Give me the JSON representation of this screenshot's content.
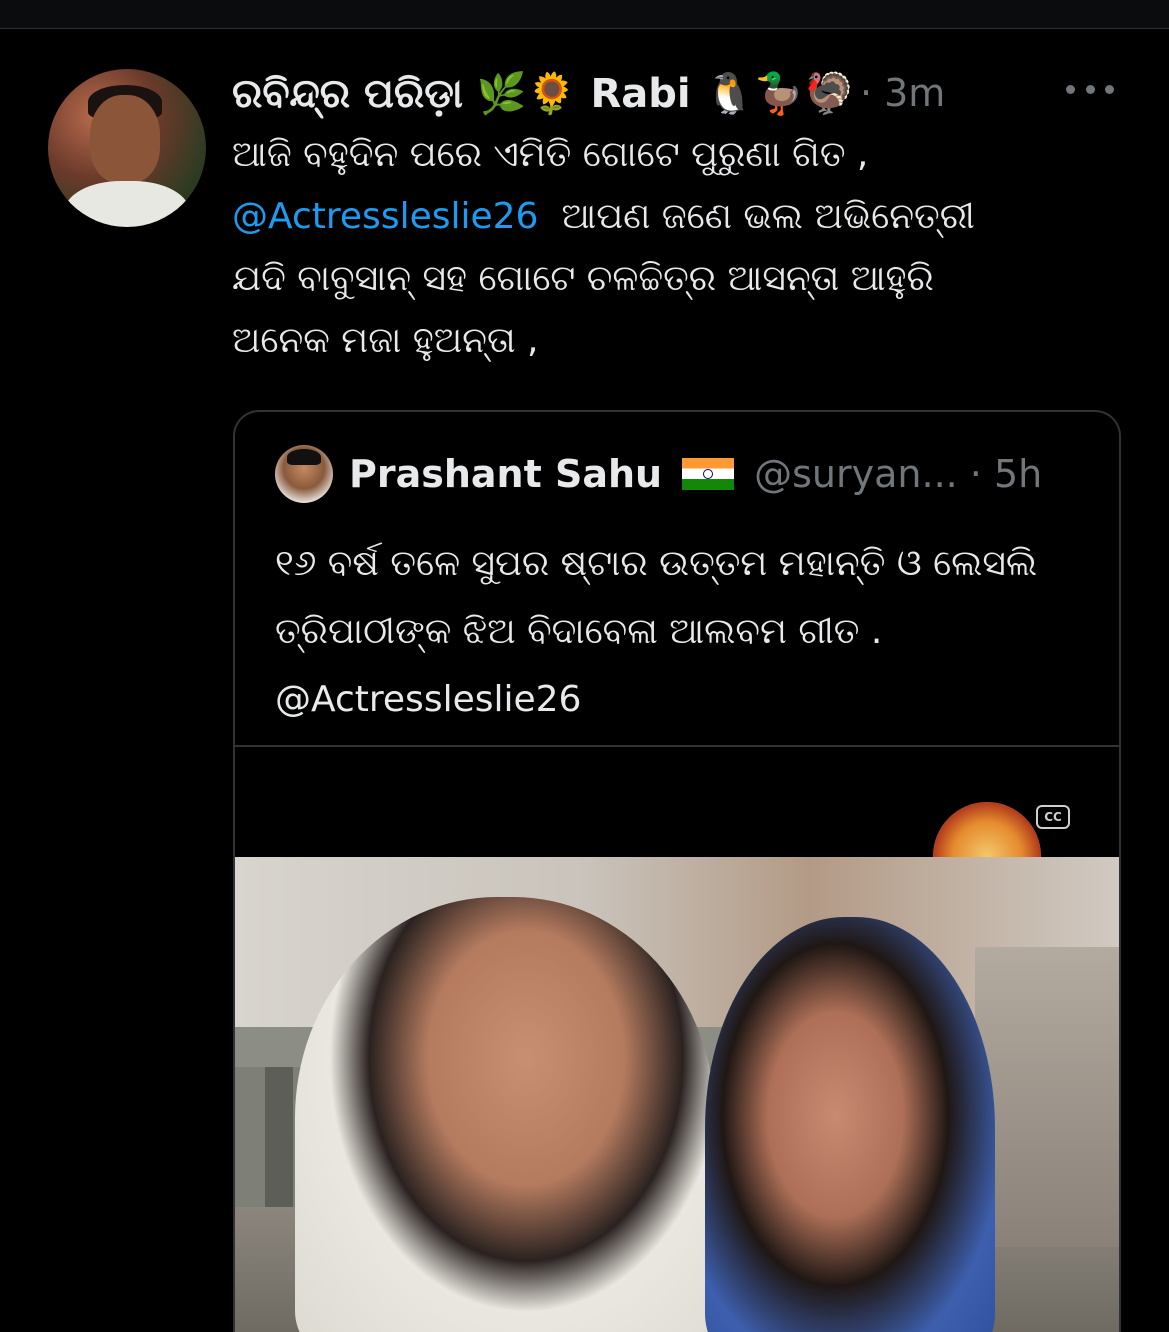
{
  "tweet": {
    "author": {
      "display_name": "ରବିନ୍ଦ୍ର ପରିଡ଼ା 🌿🌻 Rabi 🐧🦆🦃",
      "timestamp": "· 3m"
    },
    "text_lines": [
      "ଆଜି ବହୁଦିନ ପରେ ଏମିତି ଗୋଟେ ପୁରୁଣା ଗିତ ,",
      "ଆପଣ ଜଣେ ଭଲ ଅଭିନେତ୍ରୀ",
      "ଯଦି ବାବୁସାନ୍ ସହ ଗୋଟେ ଚଳଚ୍ଚିତ୍ର ଆସନ୍ତା ଆହୁରି",
      "ଅନେକ ମଜା ହୁଅନ୍ତା  ,"
    ],
    "mention": "@Actressleslie26",
    "more_icon": "more-horizontal-icon"
  },
  "quote": {
    "display_name": "Prashant Sahu",
    "flag_icon": "india-flag-icon",
    "handle_time": "@suryan... · 5h",
    "text_lines": [
      "୧୬ ବର୍ଷ ତଳେ ସୁପର ଷ୍ଟାର ଉତ୍ତମ ମହାନ୍ତି ଓ ଲେସଲି",
      "ତ୍ରିପାଠୀଙ୍କ ଝିଅ ବିଦାବେଳା ଆଲବମ ଗୀତ .",
      "@Actressleslie26"
    ],
    "media": {
      "cc_label": "CC"
    }
  },
  "colors": {
    "background": "#000000",
    "text": "#e7e9ea",
    "muted": "#71767b",
    "link": "#1d9bf0",
    "border": "#2f3336"
  }
}
